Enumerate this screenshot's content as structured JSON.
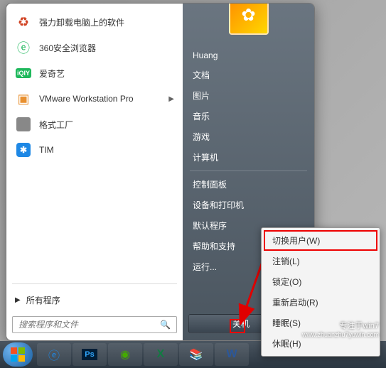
{
  "programs": [
    {
      "label": "强力卸载电脑上的软件",
      "icon": "uninstall-icon",
      "submenu": false
    },
    {
      "label": "360安全浏览器",
      "icon": "360-browser-icon",
      "submenu": false
    },
    {
      "label": "爱奇艺",
      "icon": "iqiyi-icon",
      "submenu": false
    },
    {
      "label": "VMware Workstation Pro",
      "icon": "vmware-icon",
      "submenu": true
    },
    {
      "label": "格式工厂",
      "icon": "format-factory-icon",
      "submenu": false
    },
    {
      "label": "TIM",
      "icon": "tim-icon",
      "submenu": false
    }
  ],
  "all_programs_label": "所有程序",
  "search": {
    "placeholder": "搜索程序和文件"
  },
  "user_name": "Huang",
  "right_items_top": [
    "文档",
    "图片",
    "音乐",
    "游戏",
    "计算机"
  ],
  "right_items_bottom": [
    "控制面板",
    "设备和打印机",
    "默认程序",
    "帮助和支持",
    "运行..."
  ],
  "shutdown_label": "关机",
  "power_menu": [
    {
      "label": "切换用户(W)",
      "highlighted": true
    },
    {
      "label": "注销(L)",
      "highlighted": false
    },
    {
      "label": "锁定(O)",
      "highlighted": false
    },
    {
      "label": "重新启动(R)",
      "highlighted": false
    },
    {
      "label": "睡眠(S)",
      "highlighted": false
    },
    {
      "label": "休眠(H)",
      "highlighted": false
    }
  ],
  "taskbar_items": [
    "ie",
    "ps",
    "flash",
    "excel",
    "winrar",
    "word"
  ],
  "watermark": {
    "line1": "专注于win7",
    "line2": "www.zhuanzhu7yuwin.com"
  },
  "colors": {
    "highlight_red": "#e00000",
    "panel_dark": "#4a555f"
  }
}
